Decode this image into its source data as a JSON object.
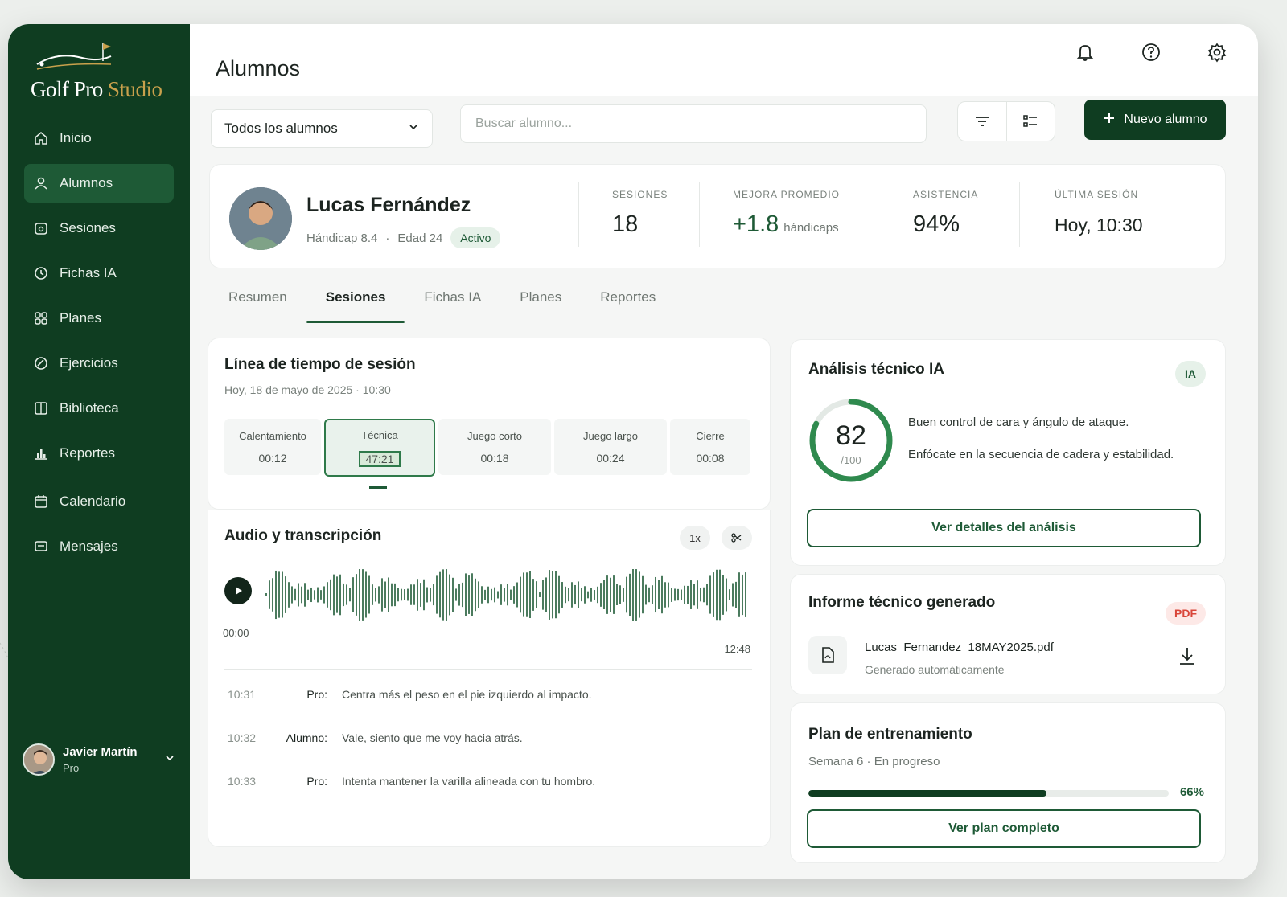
{
  "brand": {
    "name_white": "Golf Pro",
    "name_gold": "Studio"
  },
  "sidebar": {
    "items": [
      {
        "label": "Inicio",
        "icon": "home-icon"
      },
      {
        "label": "Alumnos",
        "icon": "users-icon",
        "active": true
      },
      {
        "label": "Sesiones",
        "icon": "calendar-session-icon"
      },
      {
        "label": "Fichas IA",
        "icon": "clock-icon"
      },
      {
        "label": "Planes",
        "icon": "grid-icon"
      },
      {
        "label": "Ejercicios",
        "icon": "exercise-icon"
      },
      {
        "label": "Biblioteca",
        "icon": "book-icon"
      },
      {
        "label": "Reportes",
        "icon": "bar-chart-icon"
      },
      {
        "label": "Calendario",
        "icon": "calendar-icon"
      },
      {
        "label": "Mensajes",
        "icon": "message-icon"
      }
    ],
    "user": {
      "name": "Javier Martín",
      "role": "Pro"
    }
  },
  "header": {
    "title": "Alumnos"
  },
  "toolbar": {
    "filter_value": "Todos los alumnos",
    "search_placeholder": "Buscar alumno...",
    "new_label": "Nuevo alumno"
  },
  "student": {
    "name": "Lucas Fernández",
    "handicap": "Hándicap 8.4",
    "separator": "·",
    "age": "Edad 24",
    "status": "Activo",
    "stats": {
      "sessions_label": "SESIONES",
      "sessions_value": "18",
      "improvement_label": "MEJORA PROMEDIO",
      "improvement_value": "+1.8",
      "improvement_unit": "hándicaps",
      "attendance_label": "ASISTENCIA",
      "attendance_value": "94%",
      "last_label": "ÚLTIMA SESIÓN",
      "last_value": "Hoy, 10:30"
    }
  },
  "tabs": [
    "Resumen",
    "Sesiones",
    "Fichas IA",
    "Planes",
    "Reportes"
  ],
  "timeline": {
    "title": "Línea de tiempo de sesión",
    "subtitle": "Hoy, 18 de mayo de 2025 · 10:30",
    "segments": [
      {
        "label": "Calentamiento",
        "time": "00:12"
      },
      {
        "label": "Técnica",
        "time": "47:21"
      },
      {
        "label": "Juego corto",
        "time": "00:18"
      },
      {
        "label": "Juego largo",
        "time": "00:24"
      },
      {
        "label": "Cierre",
        "time": "00:08"
      }
    ]
  },
  "audio": {
    "title": "Audio y transcripción",
    "speed": "1x",
    "start": "00:00",
    "end": "12:48",
    "lines": [
      {
        "time": "10:31",
        "speaker": "Pro:",
        "text": "Centra más el peso en el pie izquierdo al impacto."
      },
      {
        "time": "10:32",
        "speaker": "Alumno:",
        "text": "Vale, siento que me voy hacia atrás."
      },
      {
        "time": "10:33",
        "speaker": "Pro:",
        "text": "Intenta mantener la varilla alineada con tu hombro."
      }
    ]
  },
  "analysis": {
    "title": "Análisis técnico IA",
    "badge": "IA",
    "score": "82",
    "score_max": "/100",
    "score_fraction": 0.82,
    "line1": "Buen control de cara y ángulo de ataque.",
    "line2": "Enfócate en la secuencia de cadera y estabilidad.",
    "button": "Ver detalles del análisis"
  },
  "report": {
    "title": "Informe técnico generado",
    "badge": "PDF",
    "file_name": "Lucas_Fernandez_18MAY2025.pdf",
    "file_sub": "Generado automáticamente"
  },
  "plan": {
    "title": "Plan de entrenamiento",
    "subtitle": "Semana 6 · En progreso",
    "progress": 0.66,
    "progress_label": "66%",
    "button": "Ver plan completo"
  },
  "colors": {
    "sidebar": "#0f3d21",
    "accent": "#1e5a36",
    "gold": "#c9a14c",
    "pdf": "#d9463a"
  }
}
